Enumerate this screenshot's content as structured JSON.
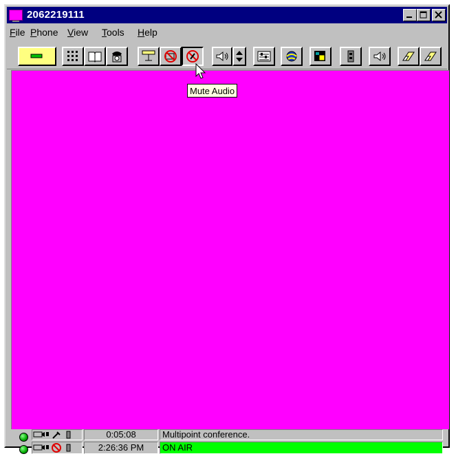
{
  "window": {
    "title": "2062219111"
  },
  "title_buttons": {
    "minimize": "_",
    "maximize": "□",
    "close": "✕"
  },
  "menu": [
    {
      "label": "File",
      "accel": "F",
      "rest": "ile"
    },
    {
      "label": "Phone",
      "accel": "P",
      "rest": "hone"
    },
    {
      "label": "View",
      "accel": "V",
      "rest": "iew"
    },
    {
      "label": "Tools",
      "accel": "T",
      "rest": "ools"
    },
    {
      "label": "Help",
      "accel": "H",
      "rest": "elp"
    }
  ],
  "toolbar": {
    "buttons": [
      "display-mode-icon",
      "keypad-icon",
      "phonebook-icon",
      "dial-icon",
      "camera-icon",
      "video-mute-icon",
      "mute-audio-icon",
      "speaker-icon",
      "volume-updown-icon",
      "settings-icon",
      "network-icon",
      "picture-in-picture-icon",
      "intercom-icon",
      "speaker-volume-icon",
      "eraser-icon",
      "eraser-icon"
    ],
    "hovered": "mute-audio-icon"
  },
  "tooltip": {
    "text": "Mute Audio"
  },
  "video_color": "#ff00ff",
  "status": {
    "rows": [
      {
        "timer": "0:05:08",
        "message": "Multipoint conference."
      },
      {
        "timer": "2:26:36 PM",
        "message": "ON AIR",
        "highlight": "#00ff00"
      }
    ]
  }
}
